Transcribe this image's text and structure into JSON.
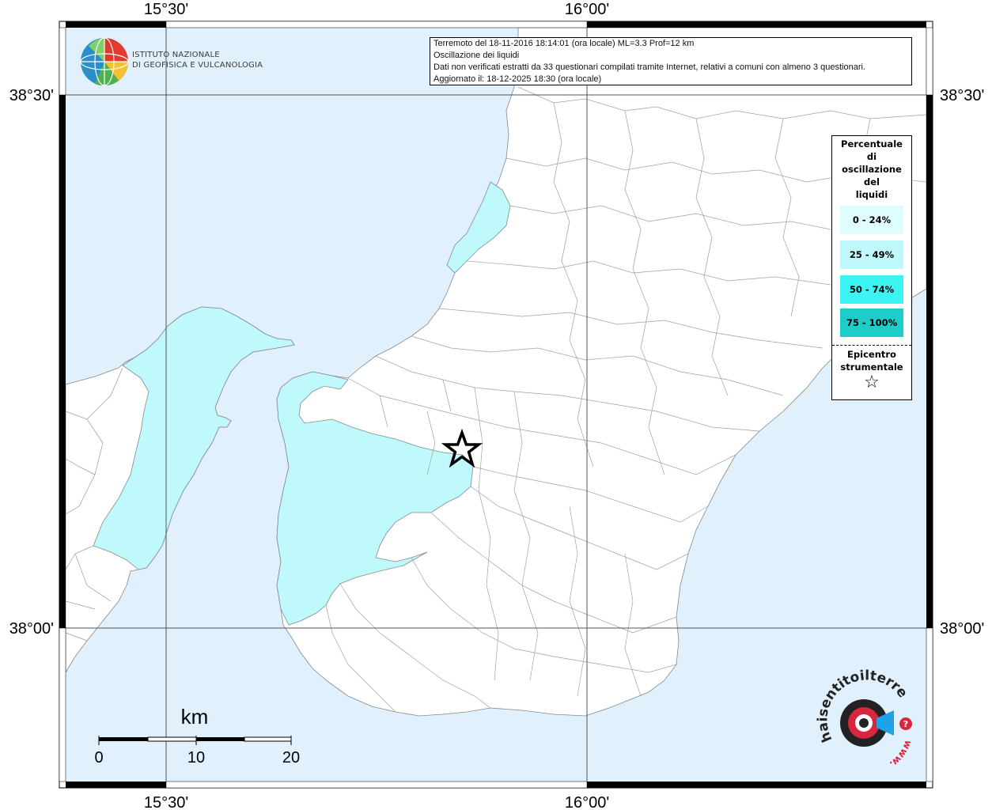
{
  "map": {
    "lon_ticks": [
      "15°30'",
      "16°00'"
    ],
    "lat_ticks": [
      "38°30'",
      "38°00'"
    ],
    "scale": {
      "unit": "km",
      "labels": [
        "0",
        "10",
        "20"
      ]
    },
    "colors": {
      "sea": "#e0f0fc",
      "land": "#ffffff",
      "cyan_class": "#bff9fb",
      "border": "#000000"
    }
  },
  "header_logo": {
    "name_line1": "ISTITUTO NAZIONALE",
    "name_line2": "DI GEOFISICA E VULCANOLOGIA"
  },
  "info": {
    "line1": "Terremoto del 18-11-2016 18:14:01 (ora locale) ML=3.3 Prof=12 km",
    "line2": "Oscillazione dei liquidi",
    "line3": "Dati non verificati estratti da 33 questionari compilati tramite Internet, relativi a comuni con almeno 3 questionari.",
    "line4": "Aggiornato il: 18-12-2025 18:30 (ora locale)"
  },
  "legend": {
    "title_lines": [
      "Percentuale",
      "di",
      "oscillazione",
      "del",
      "liquidi"
    ],
    "items": [
      {
        "label": "0 - 24%",
        "color": "#e0fdfd"
      },
      {
        "label": "25 - 49%",
        "color": "#bff9fb"
      },
      {
        "label": "50 - 74%",
        "color": "#3cf5f3"
      },
      {
        "label": "75 - 100%",
        "color": "#1ccdc8"
      }
    ],
    "epicenter_lines": [
      "Epicentro",
      "strumentale"
    ],
    "epicenter_symbol": "☆"
  },
  "footer_logo": {
    "text": "haisentitoilterremoto.it",
    "prefix": "www.",
    "colors": {
      "dark": "#222222",
      "red": "#d7263d",
      "blue": "#1fa3e8"
    }
  }
}
